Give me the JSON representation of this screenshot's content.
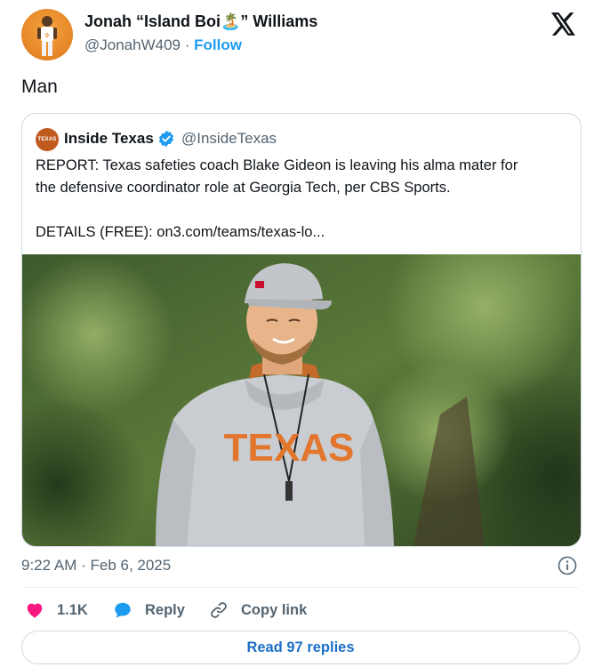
{
  "author": {
    "name": "Jonah “Island Boi🏝️” Williams",
    "handle": "@JonahW409",
    "separator": "·",
    "follow_label": "Follow"
  },
  "tweet": {
    "text": "Man",
    "timestamp": "9:22 AM · Feb 6, 2025"
  },
  "quoted": {
    "avatar_text": "TEXAS",
    "name": "Inside Texas",
    "handle": "@InsideTexas",
    "line1": "REPORT: Texas safeties coach Blake Gideon is leaving his alma mater for",
    "line2": "the defensive coordinator role at Georgia Tech, per CBS Sports.",
    "line3": "DETAILS (FREE): on3.com/teams/texas-lo...",
    "photo_shirt_text": "TEXAS"
  },
  "actions": {
    "like_count": "1.1K",
    "reply_label": "Reply",
    "copy_label": "Copy link"
  },
  "read_replies_label": "Read 97 replies",
  "icons": {
    "x_logo": "x-logo-icon",
    "verified": "verified-badge-icon",
    "info": "info-icon",
    "like": "heart-icon",
    "reply": "speech-bubble-icon",
    "copy": "link-icon"
  },
  "colors": {
    "accent": "#1d9bf0",
    "like": "#f91880",
    "muted": "#536471",
    "texas_orange": "#bf5700"
  }
}
